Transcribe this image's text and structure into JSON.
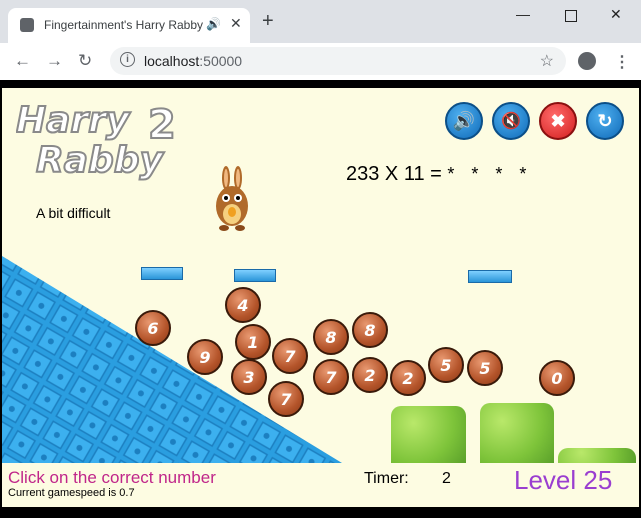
{
  "browser": {
    "tab_title": "Fingertainment's Harry Rabby",
    "tab_audio_icon": "speaker-icon",
    "new_tab_label": "+",
    "url_host": "localhost",
    "url_port": ":50000"
  },
  "game": {
    "logo_line1": "Harry",
    "logo_line2": "Rabby",
    "logo_number": "2",
    "difficulty": "A bit difficult",
    "question": "233 X 11 =",
    "answer_mask": "* * * *",
    "controls": [
      {
        "name": "sound-on-button",
        "icon": "speaker-on-icon"
      },
      {
        "name": "sound-off-button",
        "icon": "speaker-mute-icon"
      },
      {
        "name": "quit-button",
        "icon": "close-icon"
      },
      {
        "name": "restart-button",
        "icon": "refresh-icon"
      }
    ],
    "balls": [
      "6",
      "4",
      "1",
      "7",
      "9",
      "3",
      "8",
      "8",
      "7",
      "7",
      "2",
      "2",
      "5",
      "5",
      "0"
    ]
  },
  "status": {
    "instruction": "Click on the correct number",
    "gamespeed": "Current gamespeed is 0.7",
    "timer_label": "Timer:",
    "timer_value": "2",
    "level": "Level 25"
  },
  "colors": {
    "background": "#fdfce2",
    "instruction": "#c0268a",
    "level": "#9a3ed0",
    "ball": "#b4542a",
    "ramp": "#2a9ee0"
  }
}
